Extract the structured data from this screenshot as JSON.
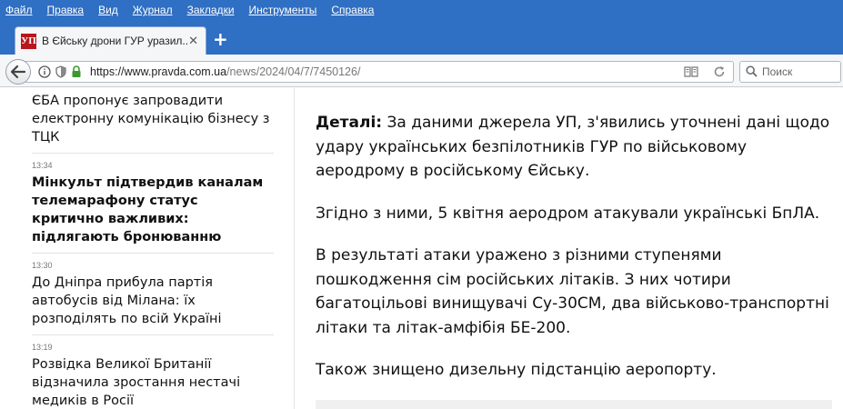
{
  "menu": [
    "Файл",
    "Правка",
    "Вид",
    "Журнал",
    "Закладки",
    "Инструменты",
    "Справка"
  ],
  "tab": {
    "favicon_text": "УП",
    "title": "В Єйську дрони ГУР уразил..."
  },
  "nav": {
    "url_domain": "https://www.pravda.com.ua",
    "url_path": "/news/2024/04/7/7450126/",
    "search_placeholder": "Поиск"
  },
  "sidebar": {
    "items": [
      {
        "time": "",
        "title": "ЄБА пропонує запровадити електронну комунікацію бізнесу з ТЦК",
        "bold": false
      },
      {
        "time": "13:34",
        "title": "Мінкульт підтвердив каналам телемарафону статус критично важливих: підлягають бронюванню",
        "bold": true
      },
      {
        "time": "13:30",
        "title": "До Дніпра прибула партія автобусів від Мілана: їх розподілять по всій Україні",
        "bold": false
      },
      {
        "time": "13:19",
        "title": "Розвідка Великої Британії відзначила зростання нестачі медиків в Росії",
        "bold": false
      }
    ]
  },
  "article": {
    "details_label": "Деталі:",
    "p1": "За даними джерела УП, з'явились уточнені дані щодо удару українських безпілотників ГУР по військовому аеродрому в російському Єйську.",
    "p2": "Згідно з ними, 5 квітня аеродром атакували українські БпЛА.",
    "p3": "В результаті атаки уражено з різними ступенями пошкодження сім російських літаків. З них чотири багатоцільові винищувачі Су-30СМ, два військово-транспортні літаки та літак-амфібія БЕ-200.",
    "p4": "Також знищено дизельну підстанцію аеропорту."
  }
}
